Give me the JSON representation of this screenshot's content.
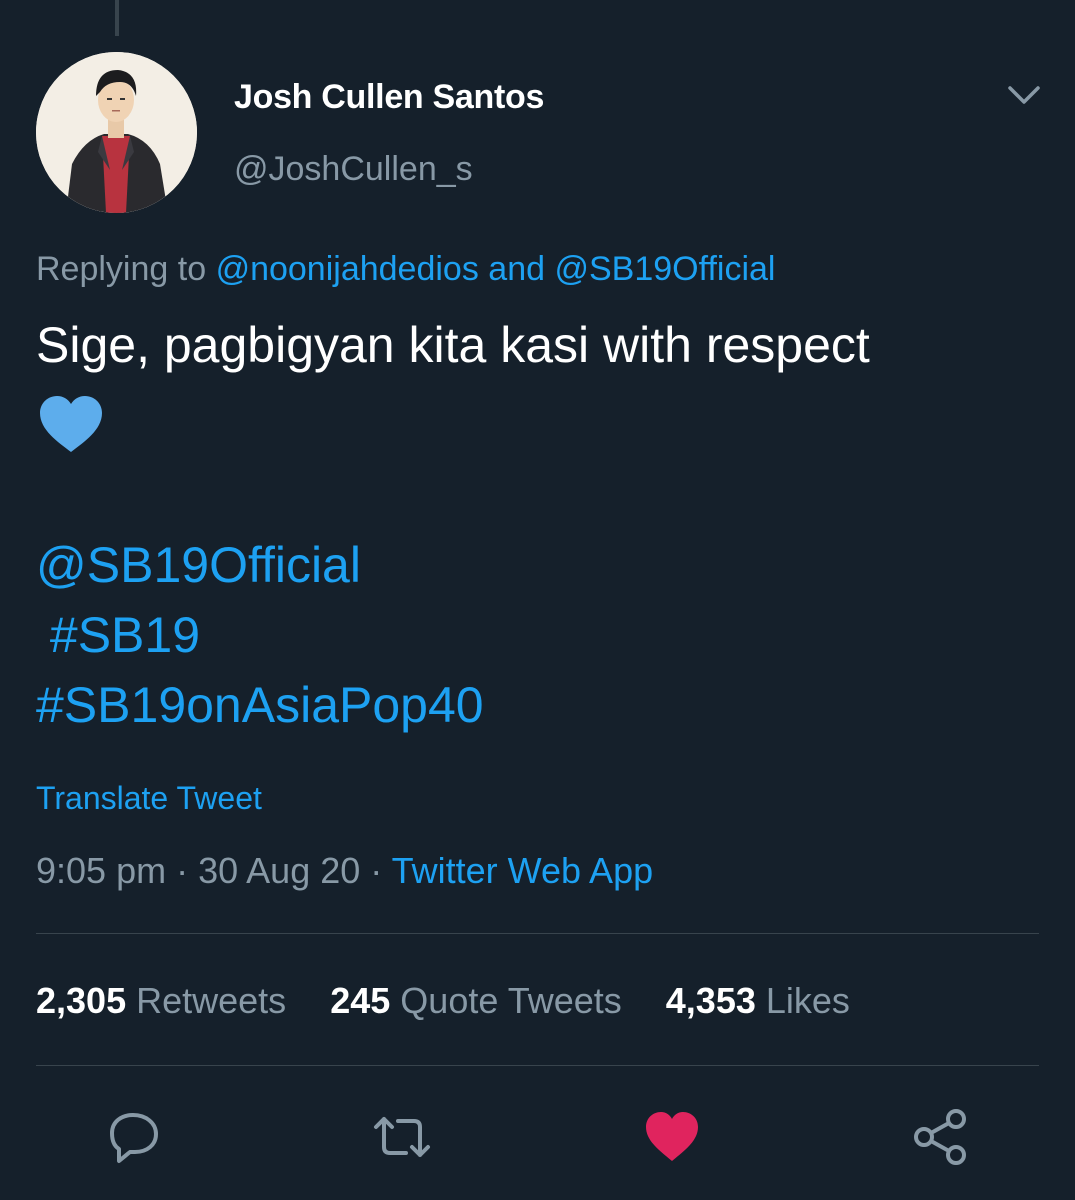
{
  "author": {
    "display_name": "Josh Cullen Santos",
    "handle": "@JoshCullen_s"
  },
  "icons": {
    "menu": "chevron-down-icon",
    "heart_emoji": "blue-heart-icon",
    "reply": "reply-icon",
    "retweet": "retweet-icon",
    "like": "heart-icon",
    "share": "share-icon"
  },
  "reply_context": {
    "prefix": "Replying to",
    "mention1": "@noonijahdedios",
    "joiner": "and",
    "mention2": "@SB19Official"
  },
  "tweet": {
    "text": "Sige, pagbigyan kita kasi with respect",
    "tags": [
      "@SB19Official",
      " #SB19",
      "#SB19onAsiaPop40"
    ]
  },
  "translate_label": "Translate Tweet",
  "meta": {
    "time": "9:05 pm",
    "separator": "·",
    "date": "30 Aug 20",
    "source": "Twitter Web App"
  },
  "stats": {
    "retweets": {
      "count": "2,305",
      "label": "Retweets"
    },
    "quotes": {
      "count": "245",
      "label": "Quote Tweets"
    },
    "likes": {
      "count": "4,353",
      "label": "Likes"
    }
  },
  "colors": {
    "background": "#15202b",
    "accent": "#1da1f2",
    "muted": "#8899a6",
    "like_active": "#e0245e",
    "heart_emoji": "#5dadec"
  }
}
